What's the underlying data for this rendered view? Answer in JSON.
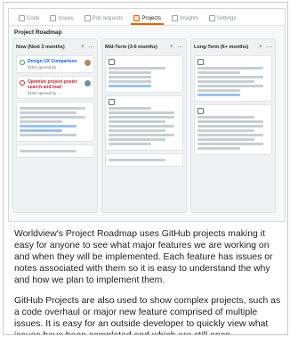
{
  "tabs": [
    {
      "label": "Code"
    },
    {
      "label": "Issues"
    },
    {
      "label": "Pull requests"
    },
    {
      "label": "Projects"
    },
    {
      "label": "Insights"
    },
    {
      "label": "Settings"
    }
  ],
  "board": {
    "title": "Project Roadmap",
    "columns": [
      {
        "title": "Now (Next 3 months)",
        "cards": [
          {
            "title": "Design UX Comparison",
            "meta": "#152 opened by ...",
            "status": "open"
          },
          {
            "title": "Optimize project poster search and load",
            "meta": "#150 opened by ...",
            "status": "closed"
          }
        ]
      },
      {
        "title": "Mid-Term (3-6 months)"
      },
      {
        "title": "Long-Term (6+ months)"
      }
    ]
  },
  "article": {
    "paragraph_1": "Worldview's Project Roadmap uses GitHub projects making it easy for anyone to see what major features we are working on and when they will be implemented. Each feature has issues or notes associated with them so it is easy to understand the why and how we plan to implement them.",
    "paragraph_2": "GitHub Projects are also used to show complex projects, such as a code overhaul or major new feature comprised of multiple issues. It is easy for an outside developer to quickly view what issues have been completed and which are still open."
  },
  "colors": {
    "active_tab": "#e36209",
    "open_issue": "#28a745",
    "closed_issue": "#cb2431",
    "link": "#0366d6"
  }
}
